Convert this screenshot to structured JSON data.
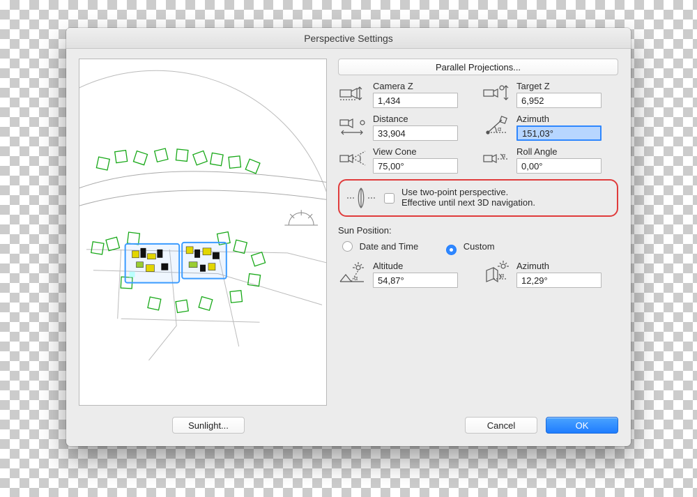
{
  "title": "Perspective Settings",
  "buttons": {
    "parallel": "Parallel Projections...",
    "sunlight": "Sunlight...",
    "cancel": "Cancel",
    "ok": "OK"
  },
  "camera": {
    "cameraZ": {
      "label": "Camera Z",
      "value": "1,434"
    },
    "targetZ": {
      "label": "Target Z",
      "value": "6,952"
    },
    "distance": {
      "label": "Distance",
      "value": "33,904"
    },
    "azimuth": {
      "label": "Azimuth",
      "value": "151,03°"
    },
    "viewCone": {
      "label": "View Cone",
      "value": "75,00°"
    },
    "rollAngle": {
      "label": "Roll Angle",
      "value": "0,00°"
    }
  },
  "twoPoint": {
    "line1": "Use two-point perspective.",
    "line2": "Effective until next 3D navigation."
  },
  "sun": {
    "sectionLabel": "Sun Position:",
    "dateTime": "Date and Time",
    "custom": "Custom",
    "altitude": {
      "label": "Altitude",
      "value": "54,87°"
    },
    "azimuth": {
      "label": "Azimuth",
      "value": "12,29°"
    }
  }
}
